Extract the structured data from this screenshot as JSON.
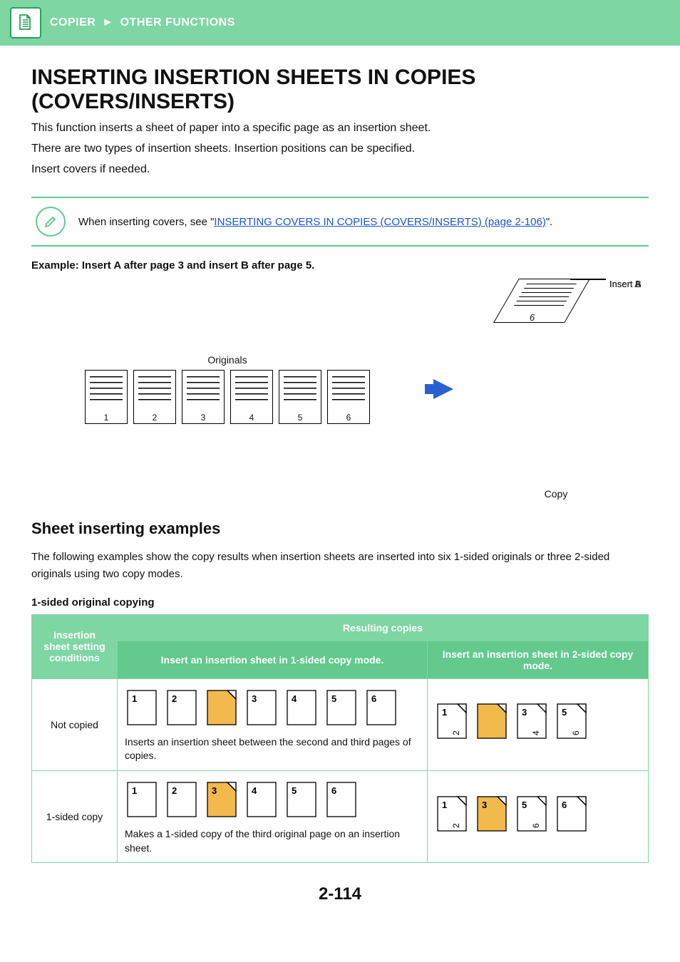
{
  "header": {
    "crumb1": "COPIER",
    "arrow": "►",
    "crumb2": "OTHER FUNCTIONS"
  },
  "title": "INSERTING INSERTION SHEETS IN COPIES (COVERS/INSERTS)",
  "intro": {
    "l1": "This function inserts a sheet of paper into a specific page as an insertion sheet.",
    "l2": "There are two types of insertion sheets. Insertion positions can be specified.",
    "l3": "Insert covers if needed."
  },
  "note": {
    "pre": "When inserting covers, see \"",
    "link": "INSERTING COVERS IN COPIES (COVERS/INSERTS) (page 2-106)",
    "post": "\"."
  },
  "example": "Example: Insert A after page 3 and insert B after page 5.",
  "diagram": {
    "originals": "Originals",
    "copy": "Copy",
    "insertA": "Insert A",
    "insertB": "Insert B",
    "p": [
      "1",
      "2",
      "3",
      "4",
      "5",
      "6"
    ]
  },
  "sec2_title": "Sheet inserting examples",
  "sec2_desc": "The following examples show the copy results when insertion sheets are inserted into six 1-sided originals or three 2-sided originals using two copy modes.",
  "subhead": "1-sided original copying",
  "table": {
    "h1": "Insertion sheet setting conditions",
    "h2": "Resulting copies",
    "h2a": "Insert an insertion sheet in 1-sided copy mode.",
    "h2b": "Insert an insertion sheet in 2-sided copy mode.",
    "rows": [
      {
        "cond": "Not copied",
        "cap": "Inserts an insertion sheet between the second and third pages of copies."
      },
      {
        "cond": "1-sided copy",
        "cap": "Makes a 1-sided copy of the third original page on an insertion sheet."
      }
    ]
  },
  "footer": "2-114"
}
